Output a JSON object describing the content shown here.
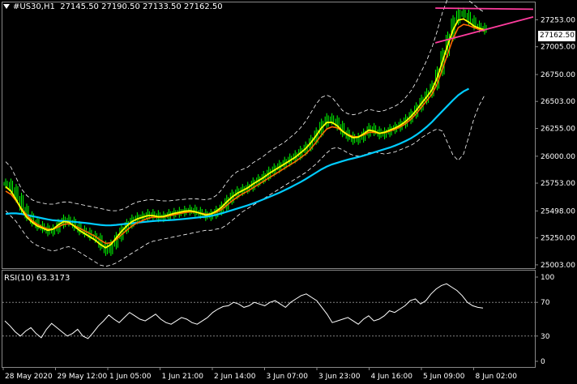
{
  "header": {
    "symbol": "#US30,H1",
    "ohlc": "27145.50 27190.50 27133.50 27162.50"
  },
  "current_price": "27162.50",
  "rsi_label": "RSI(10) 63.3173",
  "colors": {
    "background": "#000000",
    "bull_candle": "#00ff00",
    "bear_candle": "#00ff00",
    "fast_ma": "#ffff00",
    "slow_ma": "#ff6a00",
    "long_ma": "#00ccff",
    "bands": "#ffffff",
    "trendline": "#ff3c9e",
    "grid": "#808080"
  },
  "chart_data": {
    "type": "line",
    "price_axis": {
      "ticks": [
        "27253.00",
        "27005.00",
        "26750.00",
        "26503.00",
        "26255.00",
        "26000.00",
        "25753.00",
        "25498.00",
        "25250.00",
        "25003.00"
      ],
      "values": [
        27253,
        27005,
        26750,
        26503,
        26255,
        26000,
        25753,
        25498,
        25250,
        25003
      ]
    },
    "rsi_axis": {
      "ticks": [
        "100",
        "70",
        "30",
        "0"
      ],
      "values": [
        100,
        70,
        30,
        0
      ],
      "levels": [
        70,
        30
      ]
    },
    "time_axis": [
      "28 May 2020",
      "29 May 12:00",
      "1 Jun 05:00",
      "1 Jun 21:00",
      "2 Jun 14:00",
      "3 Jun 07:00",
      "3 Jun 23:00",
      "4 Jun 16:00",
      "5 Jun 09:00",
      "8 Jun 02:00"
    ],
    "price_close": [
      25750,
      25700,
      25620,
      25520,
      25450,
      25400,
      25360,
      25340,
      25310,
      25330,
      25380,
      25420,
      25400,
      25360,
      25320,
      25300,
      25270,
      25250,
      25180,
      25130,
      25190,
      25260,
      25330,
      25380,
      25420,
      25440,
      25450,
      25470,
      25460,
      25440,
      25450,
      25470,
      25480,
      25490,
      25500,
      25510,
      25490,
      25470,
      25450,
      25470,
      25500,
      25540,
      25600,
      25650,
      25680,
      25700,
      25720,
      25760,
      25790,
      25820,
      25860,
      25890,
      25920,
      25950,
      25980,
      26010,
      26050,
      26090,
      26150,
      26220,
      26300,
      26350,
      26330,
      26280,
      26220,
      26180,
      26150,
      26170,
      26210,
      26260,
      26230,
      26200,
      26220,
      26250,
      26270,
      26300,
      26340,
      26390,
      26450,
      26520,
      26580,
      26650,
      26780,
      26950,
      27100,
      27250,
      27320,
      27300,
      27250,
      27200,
      27180,
      27162.5
    ],
    "fast_ma": [
      25720,
      25680,
      25600,
      25510,
      25440,
      25395,
      25360,
      25340,
      25320,
      25330,
      25370,
      25400,
      25395,
      25360,
      25320,
      25290,
      25260,
      25230,
      25190,
      25160,
      25190,
      25250,
      25310,
      25360,
      25400,
      25425,
      25440,
      25455,
      25455,
      25445,
      25448,
      25462,
      25475,
      25485,
      25495,
      25500,
      25490,
      25475,
      25460,
      25470,
      25495,
      25530,
      25580,
      25625,
      25660,
      25685,
      25710,
      25745,
      25775,
      25805,
      25840,
      25870,
      25900,
      25930,
      25960,
      25990,
      26030,
      26070,
      26125,
      26190,
      26260,
      26310,
      26310,
      26280,
      26230,
      26195,
      26170,
      26175,
      26205,
      26240,
      26230,
      26210,
      26220,
      26240,
      26260,
      26285,
      26320,
      26365,
      26420,
      26485,
      26545,
      26610,
      26720,
      26870,
      27020,
      27160,
      27250,
      27260,
      27230,
      27195,
      27175,
      27160
    ],
    "slow_ma": [
      25680,
      25650,
      25590,
      25520,
      25460,
      25410,
      25375,
      25350,
      25330,
      25330,
      25350,
      25375,
      25380,
      25365,
      25340,
      25315,
      25290,
      25265,
      25230,
      25200,
      25205,
      25235,
      25280,
      25320,
      25360,
      25390,
      25410,
      25430,
      25440,
      25440,
      25442,
      25452,
      25463,
      25473,
      25483,
      25490,
      25487,
      25478,
      25468,
      25470,
      25485,
      25510,
      25550,
      25590,
      25625,
      25655,
      25680,
      25710,
      25740,
      25770,
      25800,
      25830,
      25860,
      25890,
      25920,
      25950,
      25985,
      26020,
      26070,
      26130,
      26195,
      26250,
      26270,
      26260,
      26230,
      26200,
      26180,
      26178,
      26195,
      26220,
      26220,
      26210,
      26215,
      26230,
      26248,
      26270,
      26300,
      26340,
      26390,
      26450,
      26510,
      26570,
      26665,
      26800,
      26940,
      27080,
      27180,
      27210,
      27200,
      27180,
      27165,
      27150
    ],
    "long_ma": [
      25470,
      25475,
      25475,
      25470,
      25460,
      25450,
      25440,
      25430,
      25420,
      25412,
      25408,
      25405,
      25402,
      25398,
      25393,
      25388,
      25382,
      25376,
      25370,
      25365,
      25366,
      25370,
      25375,
      25380,
      25385,
      25390,
      25395,
      25400,
      25405,
      25408,
      25410,
      25413,
      25416,
      25420,
      25425,
      25430,
      25435,
      25440,
      25445,
      25452,
      25462,
      25475,
      25490,
      25505,
      25520,
      25535,
      25550,
      25567,
      25585,
      25605,
      25625,
      25645,
      25665,
      25688,
      25712,
      25737,
      25762,
      25790,
      25820,
      25850,
      25880,
      25905,
      25925,
      25940,
      25955,
      25968,
      25980,
      25992,
      26005,
      26020,
      26035,
      26050,
      26065,
      26080,
      26098,
      26118,
      26140,
      26165,
      26195,
      26230,
      26270,
      26315,
      26365,
      26415,
      26465,
      26515,
      26560,
      26595,
      26620
    ],
    "upper_band": [
      25950,
      25900,
      25800,
      25700,
      25640,
      25600,
      25580,
      25570,
      25560,
      25560,
      25570,
      25580,
      25580,
      25570,
      25560,
      25550,
      25540,
      25530,
      25520,
      25510,
      25500,
      25500,
      25510,
      25530,
      25560,
      25580,
      25590,
      25600,
      25600,
      25595,
      25590,
      25590,
      25595,
      25600,
      25605,
      25610,
      25610,
      25605,
      25600,
      25610,
      25640,
      25690,
      25760,
      25820,
      25860,
      25880,
      25900,
      25940,
      25970,
      26000,
      26040,
      26070,
      26100,
      26130,
      26170,
      26210,
      26260,
      26320,
      26400,
      26480,
      26540,
      26560,
      26540,
      26480,
      26420,
      26390,
      26380,
      26390,
      26410,
      26430,
      26420,
      26410,
      26420,
      26440,
      26460,
      26490,
      26540,
      26600,
      26680,
      26780,
      26880,
      27000,
      27150,
      27320,
      27450,
      27500,
      27500,
      27470,
      27430,
      27390,
      27350,
      27320
    ],
    "lower_band": [
      25500,
      25450,
      25400,
      25330,
      25260,
      25210,
      25180,
      25160,
      25140,
      25130,
      25140,
      25160,
      25170,
      25150,
      25120,
      25090,
      25060,
      25030,
      25000,
      24990,
      25000,
      25020,
      25050,
      25080,
      25110,
      25140,
      25170,
      25200,
      25220,
      25230,
      25240,
      25250,
      25260,
      25270,
      25280,
      25290,
      25300,
      25310,
      25320,
      25320,
      25330,
      25340,
      25370,
      25410,
      25450,
      25490,
      25520,
      25550,
      25580,
      25610,
      25640,
      25670,
      25700,
      25730,
      25760,
      25790,
      25820,
      25850,
      25890,
      25930,
      25980,
      26030,
      26070,
      26080,
      26060,
      26030,
      26010,
      26000,
      26010,
      26030,
      26040,
      26030,
      26020,
      26030,
      26040,
      26060,
      26080,
      26100,
      26130,
      26170,
      26200,
      26230,
      26250,
      26230,
      26120,
      26010,
      25960,
      26020,
      26180,
      26350,
      26470,
      26560
    ],
    "rsi": [
      48,
      42,
      35,
      30,
      36,
      40,
      33,
      28,
      38,
      45,
      40,
      35,
      30,
      33,
      38,
      30,
      27,
      34,
      42,
      48,
      55,
      50,
      46,
      52,
      58,
      54,
      50,
      48,
      52,
      56,
      50,
      46,
      44,
      48,
      52,
      50,
      46,
      44,
      48,
      52,
      58,
      62,
      65,
      66,
      70,
      68,
      64,
      66,
      70,
      68,
      66,
      70,
      72,
      68,
      64,
      70,
      74,
      78,
      80,
      76,
      72,
      64,
      56,
      46,
      48,
      50,
      52,
      48,
      44,
      50,
      54,
      48,
      50,
      54,
      60,
      58,
      62,
      66,
      72,
      74,
      68,
      72,
      80,
      86,
      90,
      92,
      88,
      84,
      78,
      70,
      66,
      64,
      63.3
    ],
    "trendlines": [
      {
        "from": [
          0.6,
          27330
        ],
        "to": [
          1.0,
          27290
        ]
      },
      {
        "from": [
          0.6,
          27100
        ],
        "to": [
          1.0,
          27190
        ]
      }
    ]
  }
}
